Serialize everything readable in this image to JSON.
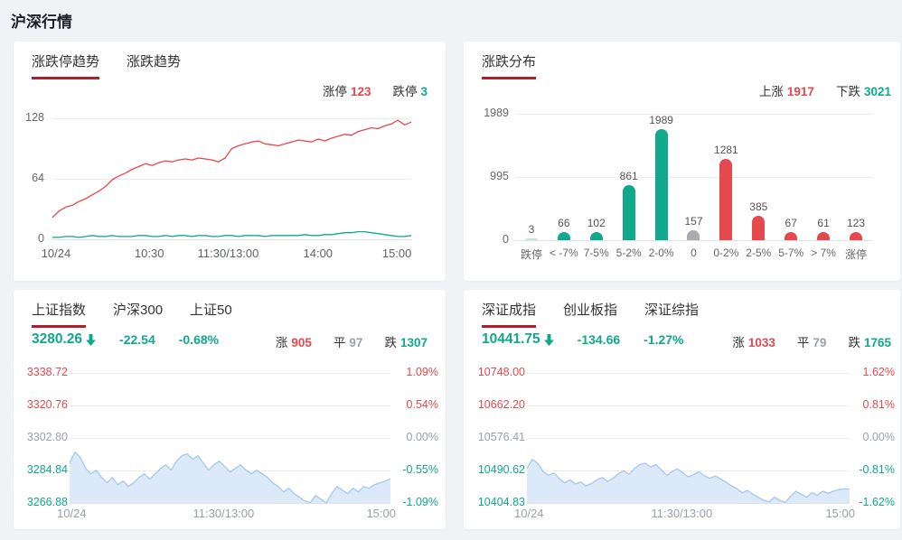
{
  "title": "沪深行情",
  "colors": {
    "red": "#e5484d",
    "green": "#0fa98a",
    "teal_bar": "#10a98c",
    "teal_bar_faint": "#bfe6df",
    "gray_bar": "#a9abaf",
    "tab_underline": "#b01f2c",
    "area_line": "#a5c8ef",
    "area_fill": "#dbe9f9",
    "grid": "#ececec"
  },
  "limit_panel": {
    "tabs": [
      "涨跌停趋势",
      "涨跌趋势"
    ],
    "stats": [
      {
        "label": "涨停",
        "value": "123",
        "color": "red"
      },
      {
        "label": "跌停",
        "value": "3",
        "color": "green"
      }
    ]
  },
  "dist_panel": {
    "tab": "涨跌分布",
    "stats": [
      {
        "label": "上涨",
        "value": "1917",
        "color": "red"
      },
      {
        "label": "下跌",
        "value": "3021",
        "color": "green"
      }
    ]
  },
  "sh_panel": {
    "tabs": [
      "上证指数",
      "沪深300",
      "上证50"
    ],
    "price": "3280.26",
    "change": "-22.54",
    "pct": "-0.68%",
    "up": {
      "label": "涨",
      "value": "905"
    },
    "flat": {
      "label": "平",
      "value": "97"
    },
    "down": {
      "label": "跌",
      "value": "1307"
    }
  },
  "sz_panel": {
    "tabs": [
      "深证成指",
      "创业板指",
      "深证综指"
    ],
    "price": "10441.75",
    "change": "-134.66",
    "pct": "-1.27%",
    "up": {
      "label": "涨",
      "value": "1033"
    },
    "flat": {
      "label": "平",
      "value": "79"
    },
    "down": {
      "label": "跌",
      "value": "1765"
    }
  },
  "chart_data": [
    {
      "type": "line",
      "title": "涨跌停趋势",
      "x_ticks": [
        "10/24",
        "10:30",
        "11:30/13:00",
        "14:00",
        "15:00"
      ],
      "yticks": [
        "128",
        "64",
        "0"
      ],
      "ylim": [
        0,
        128
      ],
      "grid": true,
      "series": [
        {
          "name": "涨停",
          "color": "#e5484d",
          "values": [
            23,
            30,
            34,
            36,
            40,
            43,
            47,
            51,
            56,
            63,
            67,
            70,
            74,
            77,
            80,
            78,
            81,
            83,
            82,
            84,
            85,
            84,
            86,
            85,
            84,
            82,
            86,
            96,
            99,
            101,
            103,
            104,
            101,
            100,
            99,
            101,
            103,
            105,
            104,
            103,
            106,
            104,
            107,
            109,
            111,
            110,
            114,
            116,
            118,
            117,
            120,
            122,
            126,
            121,
            124
          ]
        },
        {
          "name": "跌停",
          "color": "#10a98c",
          "values": [
            2,
            2,
            3,
            3,
            2,
            3,
            4,
            3,
            3,
            4,
            3,
            3,
            3,
            4,
            4,
            3,
            3,
            4,
            3,
            4,
            4,
            3,
            4,
            4,
            3,
            3,
            4,
            4,
            3,
            4,
            4,
            4,
            3,
            4,
            4,
            4,
            4,
            4,
            5,
            4,
            4,
            5,
            5,
            6,
            7,
            7,
            8,
            8,
            7,
            6,
            5,
            4,
            3,
            3,
            4
          ]
        }
      ]
    },
    {
      "type": "bar",
      "title": "涨跌分布",
      "categories": [
        "跌停",
        "< -7%",
        "7-5%",
        "5-2%",
        "2-0%",
        "0",
        "0-2%",
        "2-5%",
        "5-7%",
        "> 7%",
        "涨停"
      ],
      "values": [
        3,
        66,
        102,
        861,
        1989,
        157,
        1281,
        385,
        67,
        61,
        123
      ],
      "bar_colors": [
        "#bfe6df",
        "#10a98c",
        "#10a98c",
        "#10a98c",
        "#10a98c",
        "#a9abaf",
        "#e5484d",
        "#e5484d",
        "#e5484d",
        "#e5484d",
        "#e5484d"
      ],
      "yticks": [
        "1989",
        "995",
        "0"
      ],
      "ylim": [
        0,
        1989
      ],
      "grid": true
    },
    {
      "type": "area",
      "title": "上证指数",
      "x_ticks": [
        "10/24",
        "11:30/13:00",
        "15:00"
      ],
      "y_left_labels": [
        "3338.72",
        "3320.76",
        "3302.80",
        "3284.84",
        "3266.88"
      ],
      "y_right_labels": [
        "1.09%",
        "0.54%",
        "0.00%",
        "-0.55%",
        "-1.09%"
      ],
      "label_colors": [
        "red",
        "red",
        "gray",
        "green",
        "green"
      ],
      "ylim": [
        3266.88,
        3338.72
      ],
      "prev_close": 3302.8,
      "grid": true,
      "series": [
        {
          "name": "上证指数",
          "color": "#a5c8ef",
          "fill": "#dbe9f9",
          "values": [
            3289,
            3295,
            3292,
            3286,
            3283,
            3285,
            3281,
            3278,
            3281,
            3277,
            3279,
            3276,
            3278,
            3281,
            3283,
            3280,
            3283,
            3286,
            3288,
            3285,
            3290,
            3293,
            3294,
            3291,
            3293,
            3289,
            3285,
            3288,
            3290,
            3287,
            3284,
            3286,
            3288,
            3285,
            3283,
            3285,
            3283,
            3281,
            3278,
            3276,
            3273,
            3275,
            3272,
            3270,
            3268,
            3267,
            3271,
            3269,
            3267,
            3272,
            3276,
            3274,
            3272,
            3275,
            3273,
            3276,
            3275,
            3277,
            3278,
            3279,
            3280.26
          ]
        }
      ]
    },
    {
      "type": "area",
      "title": "深证成指",
      "x_ticks": [
        "10/24",
        "11:30/13:00",
        "15:00"
      ],
      "y_left_labels": [
        "10748.00",
        "10662.20",
        "10576.41",
        "10490.62",
        "10404.83"
      ],
      "y_right_labels": [
        "1.62%",
        "0.81%",
        "0.00%",
        "-0.81%",
        "-1.62%"
      ],
      "label_colors": [
        "red",
        "red",
        "gray",
        "green",
        "green"
      ],
      "ylim": [
        10404.83,
        10748.0
      ],
      "prev_close": 10576.41,
      "grid": true,
      "series": [
        {
          "name": "深证成指",
          "color": "#a5c8ef",
          "fill": "#dbe9f9",
          "values": [
            10496,
            10520,
            10510,
            10488,
            10478,
            10484,
            10470,
            10458,
            10466,
            10455,
            10460,
            10450,
            10456,
            10466,
            10472,
            10462,
            10470,
            10482,
            10490,
            10480,
            10496,
            10506,
            10510,
            10500,
            10506,
            10492,
            10478,
            10488,
            10495,
            10484,
            10474,
            10480,
            10487,
            10477,
            10470,
            10476,
            10468,
            10460,
            10450,
            10443,
            10432,
            10438,
            10428,
            10420,
            10412,
            10408,
            10420,
            10412,
            10406,
            10422,
            10436,
            10428,
            10420,
            10432,
            10425,
            10436,
            10430,
            10436,
            10440,
            10442,
            10441.75
          ]
        }
      ]
    }
  ]
}
